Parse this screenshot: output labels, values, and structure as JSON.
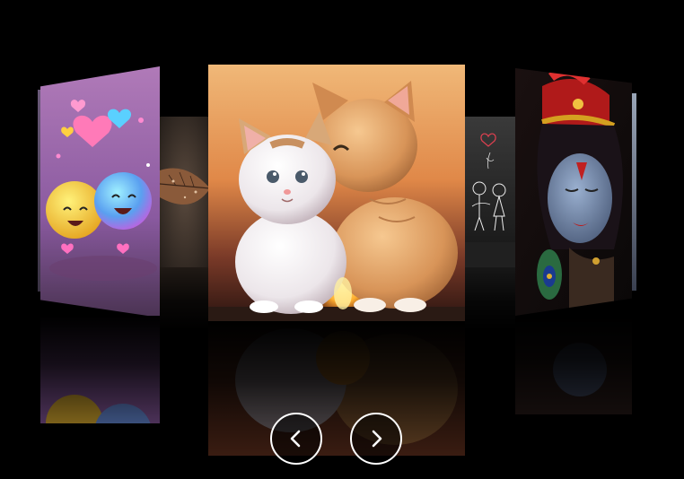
{
  "gallery": {
    "slides": [
      {
        "label": "emoji-hearts-wallpaper"
      },
      {
        "label": "autumn-leaf-wallpaper"
      },
      {
        "label": "kittens-sunset-wallpaper"
      },
      {
        "label": "sketch-couple-wallpaper"
      },
      {
        "label": "krishna-wallpaper"
      }
    ],
    "active_slide": 3,
    "colors": {
      "background": "#000000",
      "nav_border": "#ffffff"
    }
  },
  "navigation": {
    "prev_icon": "chevron-left-icon",
    "next_icon": "chevron-right-icon"
  }
}
